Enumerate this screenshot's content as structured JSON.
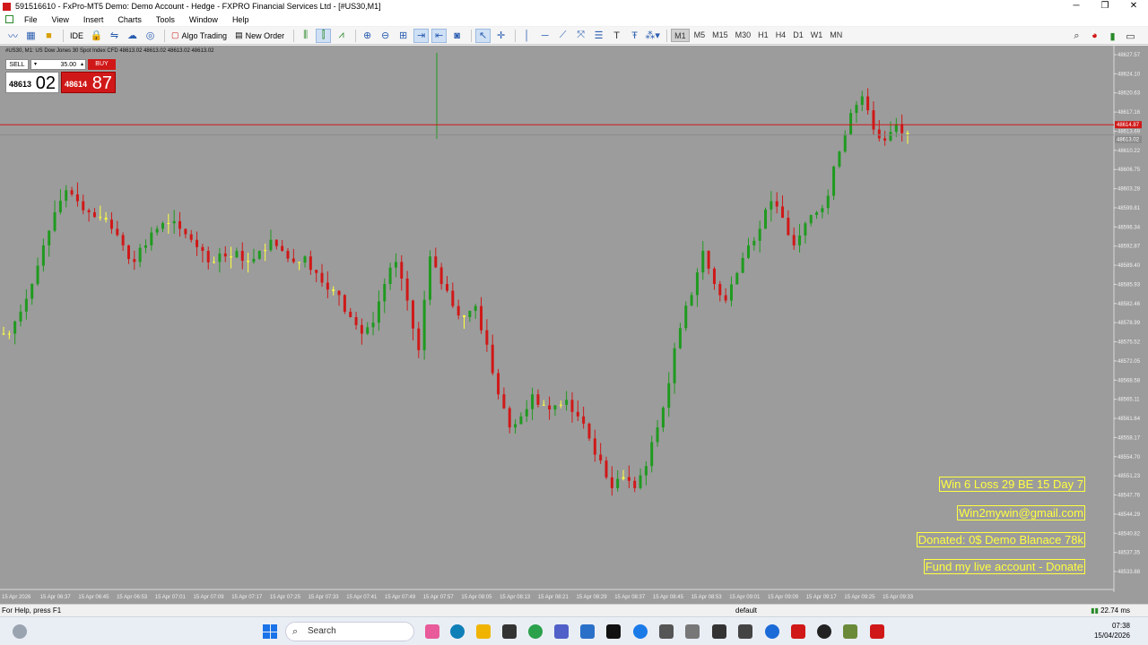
{
  "window": {
    "title": "591516610 - FxPro-MT5 Demo: Demo Account - Hedge - FXPRO Financial Services Ltd - [#US30,M1]"
  },
  "menu": [
    "File",
    "View",
    "Insert",
    "Charts",
    "Tools",
    "Window",
    "Help"
  ],
  "toolbar": {
    "ide_label": "IDE",
    "algo_trading_label": "Algo Trading",
    "new_order_label": "New Order",
    "timeframes": [
      "M1",
      "M5",
      "M15",
      "M30",
      "H1",
      "H4",
      "D1",
      "W1",
      "MN"
    ],
    "active_timeframe": "M1",
    "text_tool_label": "T",
    "notification_count": "1"
  },
  "chart": {
    "header": "#US30, M1: US Dow Jones 30 Spot Index CFD   48613.02 48613.02 48613.02 48613.02",
    "background": "#9c9c9c",
    "bull_color": "#1f9a1f",
    "bear_color": "#d01818",
    "doji_color": "#ffff40",
    "current_price_label": "48614.87",
    "bid_line_label": "48613.02",
    "trade_panel": {
      "sell_label": "SELL",
      "buy_label": "BUY",
      "lot": "35.00",
      "bid_prefix": "48613",
      "bid_big": "02",
      "ask_prefix": "48614",
      "ask_big": "87"
    },
    "overlays": [
      "Win 6  Loss 29  BE 15  Day 7",
      "Win2mywin@gmail.com",
      "Donated: 0$  Demo Blanace 78k",
      "Fund my live account - Donate"
    ]
  },
  "chart_data": {
    "type": "candlestick",
    "title": "#US30, M1: US Dow Jones 30 Spot Index CFD",
    "y_ticks": [
      "48627.57",
      "48624.10",
      "48620.63",
      "48617.16",
      "48613.69",
      "48610.22",
      "48606.75",
      "48603.28",
      "48599.81",
      "48596.34",
      "48592.87",
      "48589.40",
      "48585.93",
      "48582.46",
      "48578.99",
      "48575.52",
      "48572.05",
      "48568.58",
      "48565.11",
      "48561.64",
      "48558.17",
      "48554.70",
      "48551.23",
      "48547.76",
      "48544.29",
      "48540.82",
      "48537.35",
      "48533.88"
    ],
    "x_ticks": [
      "15 Apr 2026",
      "15 Apr 06:37",
      "15 Apr 06:45",
      "15 Apr 06:53",
      "15 Apr 07:01",
      "15 Apr 07:09",
      "15 Apr 07:17",
      "15 Apr 07:25",
      "15 Apr 07:33",
      "15 Apr 07:41",
      "15 Apr 07:49",
      "15 Apr 07:57",
      "15 Apr 08:05",
      "15 Apr 08:13",
      "15 Apr 08:21",
      "15 Apr 08:29",
      "15 Apr 08:37",
      "15 Apr 08:45",
      "15 Apr 08:53",
      "15 Apr 09:01",
      "15 Apr 09:09",
      "15 Apr 09:17",
      "15 Apr 09:25",
      "15 Apr 09:33"
    ],
    "ylim": [
      48532,
      48628
    ],
    "close_path": [
      48577,
      48581,
      48586,
      48593,
      48599,
      48603,
      48601,
      48599,
      48598,
      48596,
      48593,
      48590,
      48593,
      48596,
      48597,
      48596,
      48594,
      48592,
      48590,
      48591,
      48592,
      48590,
      48592,
      48594,
      48592,
      48590,
      48591,
      48588,
      48585,
      48584,
      48580,
      48577,
      48579,
      48586,
      48590,
      48583,
      48574,
      48591,
      48586,
      48582,
      48580,
      48582,
      48575,
      48566,
      48560,
      48562,
      48566,
      48564,
      48564,
      48565,
      48562,
      48558,
      48554,
      48549,
      48551,
      48549,
      48553,
      48560,
      48568,
      48578,
      48584,
      48592,
      48586,
      48583,
      48588,
      48593,
      48596,
      48601,
      48598,
      48593,
      48597,
      48599,
      48602,
      48610,
      48617,
      48620,
      48614,
      48612,
      48615,
      48613
    ]
  },
  "status": {
    "help": "For Help, press F1",
    "profile": "default",
    "ping": "22.74 ms"
  },
  "taskbar": {
    "search_label": "Search",
    "time": "07:38",
    "date": "15/04/2026"
  }
}
